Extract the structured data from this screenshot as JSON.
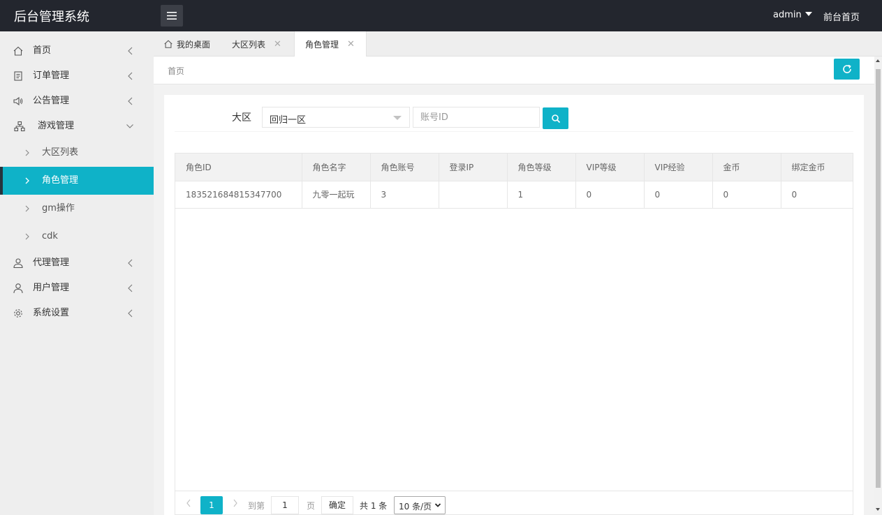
{
  "header": {
    "title": "后台管理系统",
    "user": "admin",
    "front_home": "前台首页"
  },
  "sidebar": {
    "items": [
      {
        "label": "首页",
        "icon": "home-icon"
      },
      {
        "label": "订单管理",
        "icon": "document-icon"
      },
      {
        "label": "公告管理",
        "icon": "speaker-icon"
      },
      {
        "label": "游戏管理",
        "icon": "sitemap-icon"
      },
      {
        "label": "代理管理",
        "icon": "user-group-icon"
      },
      {
        "label": "用户管理",
        "icon": "user-icon"
      },
      {
        "label": "系统设置",
        "icon": "gear-icon"
      }
    ],
    "submenu": [
      {
        "label": "大区列表"
      },
      {
        "label": "角色管理"
      },
      {
        "label": "gm操作"
      },
      {
        "label": "cdk"
      }
    ]
  },
  "tabs": [
    {
      "label": "我的桌面"
    },
    {
      "label": "大区列表"
    },
    {
      "label": "角色管理"
    }
  ],
  "breadcrumb": "首页",
  "form": {
    "region_label": "大区",
    "region_value": "回归一区",
    "account_placeholder": "账号ID"
  },
  "table": {
    "columns": [
      "角色ID",
      "角色名字",
      "角色账号",
      "登录IP",
      "角色等级",
      "VIP等级",
      "VIP经验",
      "金币",
      "绑定金币"
    ],
    "rows": [
      [
        "183521684815347700",
        "九零一起玩",
        "3",
        "",
        "1",
        "0",
        "0",
        "0",
        "0"
      ]
    ]
  },
  "pagination": {
    "current": "1",
    "goto_label": "到第",
    "goto_value": "1",
    "page_suffix": "页",
    "confirm": "确定",
    "total": "共 1 条",
    "page_size": "10 条/页"
  },
  "colors": {
    "accent": "#0fb2c8",
    "header_bg": "#23262e",
    "sidebar_bg": "#eeeeee"
  }
}
